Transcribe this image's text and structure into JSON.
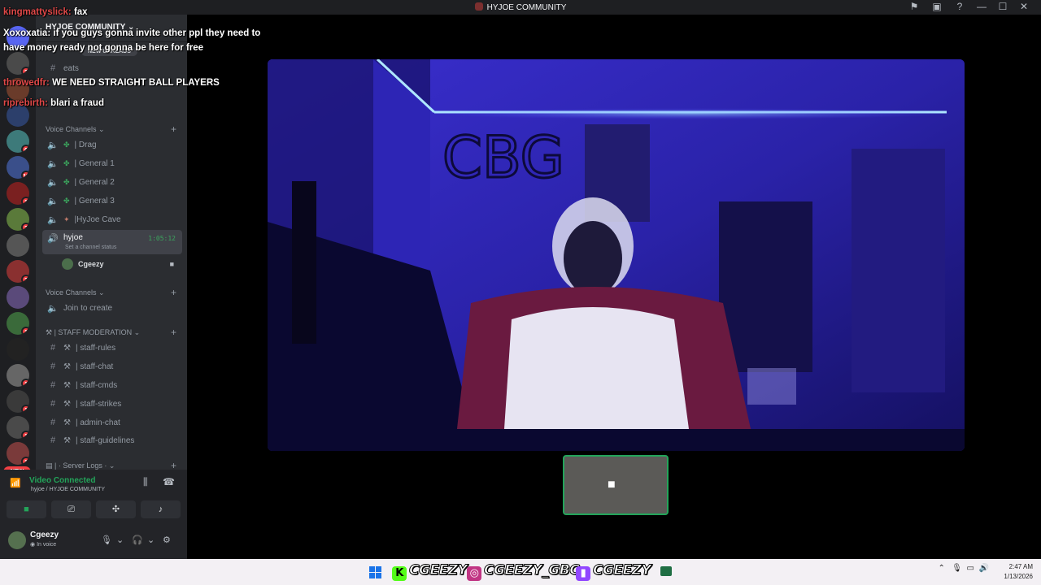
{
  "window": {
    "title": "HYJOE COMMUNITY",
    "icons": [
      "inbox-icon",
      "monitor-icon",
      "help-icon",
      "minimize-icon",
      "maximize-icon",
      "close-icon"
    ]
  },
  "guild_badges": [
    "3",
    "6",
    "11",
    "1",
    "3",
    "3",
    "1",
    "1",
    "1",
    "1",
    "1"
  ],
  "guild_new": "NEW",
  "server": {
    "name": "HYJOE COMMUNITY",
    "new_unreads": "NEW UNREADS",
    "top_channel": "eats"
  },
  "voice1": {
    "category": "Voice Channels",
    "channels": [
      "| Drag",
      "| General 1",
      "| General 2",
      "| General 3",
      "|HyJoe Cave"
    ],
    "active": {
      "name": "hyjoe",
      "status": "Set a channel status",
      "time": "1:05:12"
    },
    "member": "Cgeezy"
  },
  "voice2": {
    "category": "Voice Channels",
    "join": "Join to create"
  },
  "staff": {
    "category": "| STAFF MODERATION",
    "channels": [
      "| staff-rules",
      "| staff-chat",
      "| staff-cmds",
      "| staff-strikes",
      "| admin-chat",
      "| staff-guidelines"
    ]
  },
  "server_logs": "| · Server Logs ·",
  "voice_panel": {
    "status": "Video Connected",
    "sub": "hyjoe / HYJOE COMMUNITY"
  },
  "user": {
    "name": "Cgeezy",
    "sub": "In voice"
  },
  "chat": [
    {
      "user": "kingmattyslick:",
      "text": "fax"
    },
    {
      "user": "Xoxoxatia:",
      "text": "if you guys gonna invite other ppl they need to have money ready not gonna be here for free"
    },
    {
      "user": "throwedfr:",
      "text": "WE NEED STRAIGHT BALL PLAYERS"
    },
    {
      "user": "riprebirth:",
      "text": "blari a fraud"
    }
  ],
  "taskbar": {
    "kick": "CGEEZY",
    "instagram": "CGEEZY_GBC",
    "twitch": "CGEEZY",
    "time": "2:47 AM",
    "date": "1/13/2026"
  },
  "colors": {
    "accent_green": "#23a55a",
    "alert_red": "#f23f43",
    "video_blue": "#1c1a8a"
  }
}
